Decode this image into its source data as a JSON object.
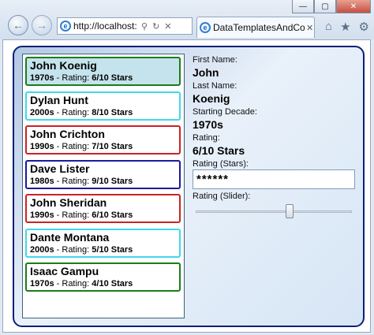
{
  "browser": {
    "url": "http://localhost:",
    "tab_title": "DataTemplatesAndCo...",
    "back_icon": "←",
    "forward_icon": "→",
    "search_icon": "⚲",
    "refresh_icon": "↻",
    "home_icon": "⌂",
    "favorites_icon": "★",
    "tools_icon": "⚙",
    "tab_close_icon": "✕",
    "minimize_icon": "—",
    "maximize_icon": "▢",
    "close_icon": "✕"
  },
  "list": {
    "rating_label": "Rating:",
    "items": [
      {
        "name": "John Koenig",
        "decade": "1970s",
        "rating": "6/10 Stars",
        "border": "#1a7d1a",
        "selected": true
      },
      {
        "name": "Dylan Hunt",
        "decade": "2000s",
        "rating": "8/10 Stars",
        "border": "#3fd9ea",
        "selected": false
      },
      {
        "name": "John Crichton",
        "decade": "1990s",
        "rating": "7/10 Stars",
        "border": "#cc2222",
        "selected": false
      },
      {
        "name": "Dave Lister",
        "decade": "1980s",
        "rating": "9/10 Stars",
        "border": "#1a1aa0",
        "selected": false
      },
      {
        "name": "John Sheridan",
        "decade": "1990s",
        "rating": "6/10 Stars",
        "border": "#cc2222",
        "selected": false
      },
      {
        "name": "Dante Montana",
        "decade": "2000s",
        "rating": "5/10 Stars",
        "border": "#3fd9ea",
        "selected": false
      },
      {
        "name": "Isaac Gampu",
        "decade": "1970s",
        "rating": "4/10 Stars",
        "border": "#1a7d1a",
        "selected": false
      }
    ]
  },
  "detail": {
    "first_name_label": "First Name:",
    "first_name": "John",
    "last_name_label": "Last Name:",
    "last_name": "Koenig",
    "decade_label": "Starting Decade:",
    "decade": "1970s",
    "rating_label": "Rating:",
    "rating": "6/10 Stars",
    "rating_stars_label": "Rating (Stars):",
    "rating_stars_value": "******",
    "rating_slider_label": "Rating (Slider):",
    "rating_slider_value": 6,
    "rating_slider_max": 10
  }
}
